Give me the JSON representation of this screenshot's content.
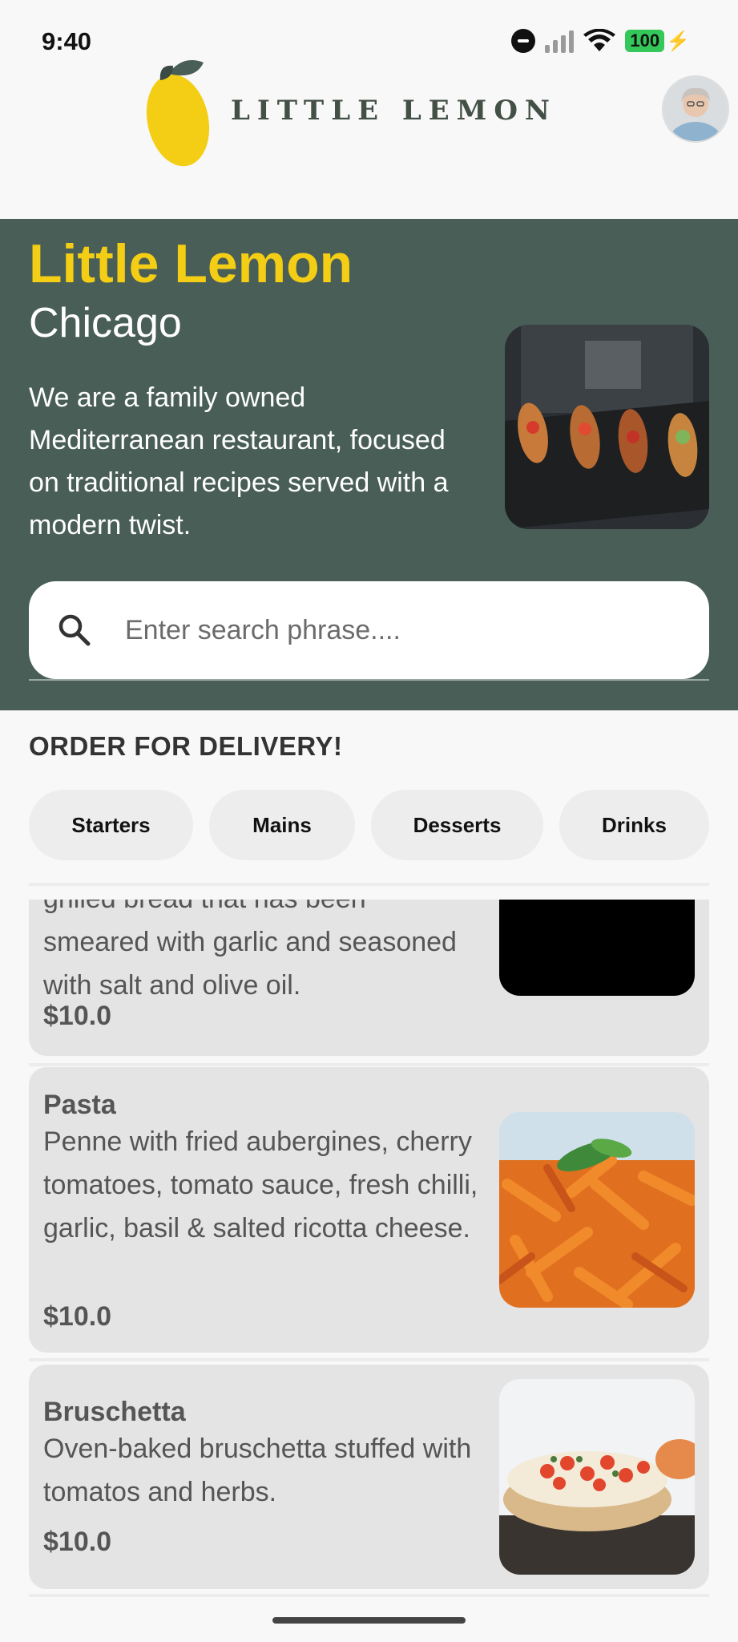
{
  "status_bar": {
    "time": "9:40",
    "battery": "100",
    "icons": [
      "do-not-disturb-icon",
      "signal-icon",
      "wifi-icon",
      "battery-icon"
    ]
  },
  "header": {
    "brand": "LITTLE LEMON",
    "logo_icon": "lemon-logo-icon",
    "avatar": "profile-avatar"
  },
  "hero": {
    "title": "Little Lemon",
    "city": "Chicago",
    "description": "We are a family owned Mediterranean restaurant, focused on traditional recipes served with a modern twist.",
    "search_placeholder": "Enter search phrase...."
  },
  "order": {
    "title": "ORDER FOR DELIVERY!",
    "categories": [
      "Starters",
      "Mains",
      "Desserts",
      "Drinks"
    ]
  },
  "menu": [
    {
      "name": "",
      "description_partial": "grilled bread that has been",
      "description": "smeared with garlic and seasoned with salt and olive oil.",
      "price": "$10.0"
    },
    {
      "name": "Pasta",
      "description": "Penne with fried aubergines, cherry tomatoes, tomato sauce, fresh chilli, garlic, basil & salted ricotta cheese.",
      "price": "$10.0"
    },
    {
      "name": "Bruschetta",
      "description": "Oven-baked bruschetta stuffed with tomatos and herbs.",
      "price": "$10.0"
    }
  ],
  "colors": {
    "primary_green": "#495e57",
    "primary_yellow": "#f4ce14",
    "card_bg": "#e4e4e4"
  }
}
